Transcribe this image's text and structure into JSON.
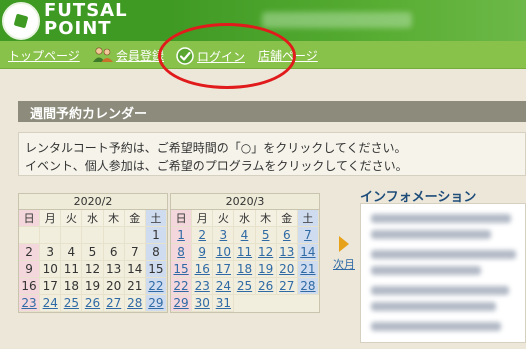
{
  "header": {
    "logo_line1": "FUTSAL",
    "logo_line2": "POINT"
  },
  "nav": {
    "items": [
      {
        "label": "トップページ"
      },
      {
        "label": "会員登録"
      },
      {
        "label": "ログイン"
      },
      {
        "label": "店舗ページ"
      }
    ]
  },
  "section": {
    "title": "週間予約カレンダー"
  },
  "instructions": {
    "line1": "レンタルコート予約は、ご希望時間の「○」をクリックしてください。",
    "line2": "イベント、個人参加は、ご希望のプログラムをクリックしてください。"
  },
  "calendar_feb": {
    "title": "2020/2",
    "weekdays": [
      "日",
      "月",
      "火",
      "水",
      "木",
      "金",
      "土"
    ],
    "days": [
      "",
      "",
      "",
      "",
      "",
      "",
      "1",
      "2",
      "3",
      "4",
      "5",
      "6",
      "7",
      "8",
      "9",
      "10",
      "11",
      "12",
      "13",
      "14",
      "15",
      "16",
      "17",
      "18",
      "19",
      "20",
      "21",
      "22",
      "23",
      "24",
      "25",
      "26",
      "27",
      "28",
      "29"
    ]
  },
  "calendar_mar": {
    "title": "2020/3",
    "weekdays": [
      "日",
      "月",
      "火",
      "水",
      "木",
      "金",
      "土"
    ],
    "days": [
      "1",
      "2",
      "3",
      "4",
      "5",
      "6",
      "7",
      "8",
      "9",
      "10",
      "11",
      "12",
      "13",
      "14",
      "15",
      "16",
      "17",
      "18",
      "19",
      "20",
      "21",
      "22",
      "23",
      "24",
      "25",
      "26",
      "27",
      "28",
      "29",
      "30",
      "31"
    ]
  },
  "next_month": {
    "label": "次月"
  },
  "info": {
    "title": "インフォメーション"
  },
  "colors": {
    "header_green": "#3f9a24",
    "nav_green": "#88c24a",
    "highlight": "#e11b1b",
    "link_blue": "#2f6aa5"
  }
}
